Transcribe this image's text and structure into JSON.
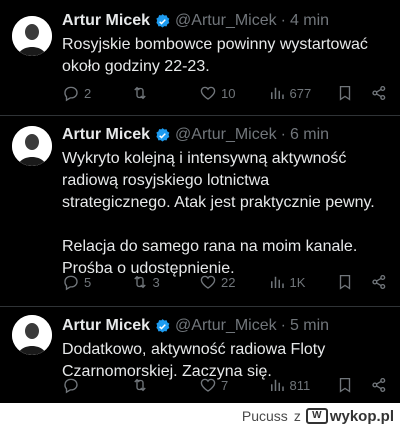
{
  "tweets": [
    {
      "name": "Artur Micek",
      "handle": "@Artur_Micek",
      "sep": "·",
      "time": "4 min",
      "text": "Rosyjskie bombowce powinny wystartować\nokoło godziny 22-23.",
      "replies": "2",
      "retweets": "",
      "likes": "10",
      "views": "677"
    },
    {
      "name": "Artur Micek",
      "handle": "@Artur_Micek",
      "sep": "·",
      "time": "6 min",
      "text": "Wykryto kolejną i intensywną aktywność\nradiową rosyjskiego lotnictwa\nstrategicznego. Atak jest praktycznie pewny.\n\nRelacja do samego rana na moim kanale.\nProśba o udostępnienie.",
      "replies": "5",
      "retweets": "3",
      "likes": "22",
      "views": "1K"
    },
    {
      "name": "Artur Micek",
      "handle": "@Artur_Micek",
      "sep": "·",
      "time": "5 min",
      "text": "Dodatkowo, aktywność radiowa Floty\nCzarnomorskiej. Zaczyna się.",
      "replies": "",
      "retweets": "",
      "likes": "7",
      "views": "811"
    }
  ],
  "footer": {
    "user": "Pucuss",
    "z": "z",
    "site": "wykop.pl",
    "logo_glyph": "W"
  },
  "colors": {
    "background": "#000000",
    "text": "#e7e9ea",
    "muted": "#71767b",
    "verified": "#1d9bf0"
  }
}
